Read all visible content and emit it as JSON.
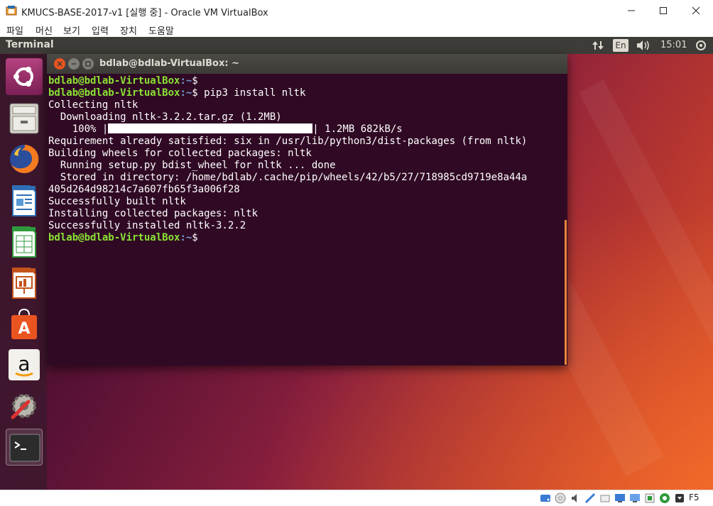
{
  "window": {
    "title": "KMUCS-BASE-2017-v1 [실행 중] - Oracle VM VirtualBox",
    "controls": {
      "minimize": "—",
      "maximize": "☐",
      "close": "✕"
    }
  },
  "menubar": [
    "파일",
    "머신",
    "보기",
    "입력",
    "장치",
    "도움말"
  ],
  "topbar": {
    "app_name": "Terminal",
    "keyboard": "En",
    "clock": "15:01"
  },
  "launcher": {
    "items": [
      {
        "name": "ubuntu-dash",
        "icon": "ubuntu-icon"
      },
      {
        "name": "files",
        "icon": "file-cabinet-icon"
      },
      {
        "name": "firefox",
        "icon": "firefox-icon"
      },
      {
        "name": "writer",
        "icon": "writer-doc-icon"
      },
      {
        "name": "calc",
        "icon": "calc-sheet-icon"
      },
      {
        "name": "impress",
        "icon": "impress-slide-icon"
      },
      {
        "name": "software",
        "icon": "shopping-bag-icon"
      },
      {
        "name": "amazon",
        "icon": "amazon-icon"
      },
      {
        "name": "system-settings",
        "icon": "wrench-gear-icon"
      },
      {
        "name": "terminal",
        "icon": "terminal-icon"
      }
    ]
  },
  "terminal": {
    "title": "bdlab@bdlab-VirtualBox: ~",
    "prompt_user": "bdlab@bdlab-VirtualBox",
    "prompt_path": ":~",
    "prompt_sign": "$",
    "command": " pip3 install nltk",
    "lines": {
      "collecting": "Collecting nltk",
      "downloading": "  Downloading nltk-3.2.2.tar.gz (1.2MB)",
      "progress_pct": "    100% |",
      "progress_rest": "| 1.2MB 682kB/s",
      "requirement": "Requirement already satisfied: six in /usr/lib/python3/dist-packages (from nltk)",
      "building": "Building wheels for collected packages: nltk",
      "running": "  Running setup.py bdist_wheel for nltk ... done",
      "stored": "  Stored in directory: /home/bdlab/.cache/pip/wheels/42/b5/27/718985cd9719e8a44a",
      "stored_cont": "405d264d98214c7a607fb65f3a006f28",
      "built": "Successfully built nltk",
      "installing": "Installing collected packages: nltk",
      "installed": "Successfully installed nltk-3.2.2"
    },
    "progress": 1.0
  },
  "statusbar": {
    "host_key": "F5"
  },
  "colors": {
    "terminal_bg": "#300a24",
    "prompt_green": "#8ae234",
    "prompt_blue": "#729fcf",
    "topbar_bg": "#3d3c38",
    "close_orange": "#e95420"
  }
}
